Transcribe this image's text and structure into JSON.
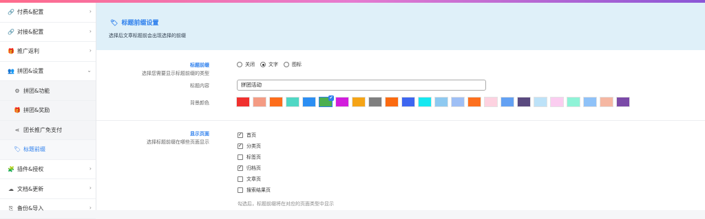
{
  "sidebar": {
    "items": [
      {
        "label": "付费&配置",
        "icon": "link-icon",
        "glyph": "🔗"
      },
      {
        "label": "对接&配置",
        "icon": "link-icon",
        "glyph": "🔗"
      },
      {
        "label": "推广返利",
        "icon": "gift-icon",
        "glyph": "🎁"
      },
      {
        "label": "拼团&设置",
        "icon": "users-icon",
        "glyph": "👥"
      },
      {
        "label": "拼团&功能",
        "icon": "gear-icon",
        "glyph": "⚙"
      },
      {
        "label": "拼团&奖励",
        "icon": "gift-icon",
        "glyph": "🎁"
      },
      {
        "label": "团长推广免支付",
        "icon": "share-icon",
        "glyph": "⋖"
      },
      {
        "label": "标题前缀",
        "icon": "tag-icon",
        "glyph": "🏷"
      },
      {
        "label": "插件&授权",
        "icon": "puzzle-icon",
        "glyph": "🧩"
      },
      {
        "label": "文档&更新",
        "icon": "cloud-icon",
        "glyph": "☁"
      },
      {
        "label": "备份&导入",
        "icon": "copy-icon",
        "glyph": "⎘"
      }
    ]
  },
  "banner": {
    "title": "标题前缀设置",
    "desc": "选择后文章标题前会出现选择的前缀"
  },
  "prefix": {
    "label": "标题前缀",
    "sublabel": "选择您需要显示标题前缀的类型",
    "options": [
      "关闭",
      "文字",
      "图标"
    ],
    "selected": "文字"
  },
  "content": {
    "label": "标题内容",
    "value": "拼团活动"
  },
  "bgcolor": {
    "label": "背景颜色",
    "colors": [
      "#f0302e",
      "#f49b83",
      "#fd6d1b",
      "#4fd7c4",
      "#2b8ef3",
      "#4caf50",
      "#d21ddc",
      "#f5a416",
      "#7f7f7f",
      "#fb6a10",
      "#3d66f0",
      "#16e8f0",
      "#8ec9f0",
      "#9ebff5",
      "#fd701e",
      "#fdd2e0",
      "#63a1f3",
      "#5a4a7f",
      "#bde2f8",
      "#fbcdf0",
      "#8ff3d7",
      "#8fc2f8",
      "#f5b7a2",
      "#7b4aa8"
    ],
    "selected_index": 5
  },
  "pages": {
    "label": "显示页面",
    "sublabel": "选择标题前缀在哪些页面显示",
    "options": [
      {
        "label": "首页",
        "checked": true
      },
      {
        "label": "分类页",
        "checked": true
      },
      {
        "label": "标签页",
        "checked": false
      },
      {
        "label": "归档页",
        "checked": true
      },
      {
        "label": "文章页",
        "checked": false
      },
      {
        "label": "搜索结果页",
        "checked": false
      }
    ],
    "hint": "勾选后，标题前缀将在对应的页面类型中显示"
  }
}
